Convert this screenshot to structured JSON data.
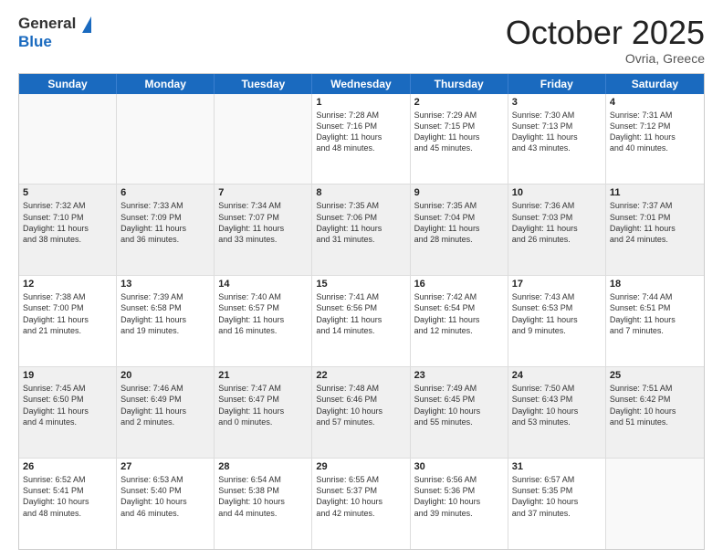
{
  "header": {
    "logo_line1": "General",
    "logo_line2": "Blue",
    "month": "October 2025",
    "location": "Ovria, Greece"
  },
  "weekdays": [
    "Sunday",
    "Monday",
    "Tuesday",
    "Wednesday",
    "Thursday",
    "Friday",
    "Saturday"
  ],
  "weeks": [
    [
      {
        "day": "",
        "info": ""
      },
      {
        "day": "",
        "info": ""
      },
      {
        "day": "",
        "info": ""
      },
      {
        "day": "1",
        "info": "Sunrise: 7:28 AM\nSunset: 7:16 PM\nDaylight: 11 hours\nand 48 minutes."
      },
      {
        "day": "2",
        "info": "Sunrise: 7:29 AM\nSunset: 7:15 PM\nDaylight: 11 hours\nand 45 minutes."
      },
      {
        "day": "3",
        "info": "Sunrise: 7:30 AM\nSunset: 7:13 PM\nDaylight: 11 hours\nand 43 minutes."
      },
      {
        "day": "4",
        "info": "Sunrise: 7:31 AM\nSunset: 7:12 PM\nDaylight: 11 hours\nand 40 minutes."
      }
    ],
    [
      {
        "day": "5",
        "info": "Sunrise: 7:32 AM\nSunset: 7:10 PM\nDaylight: 11 hours\nand 38 minutes."
      },
      {
        "day": "6",
        "info": "Sunrise: 7:33 AM\nSunset: 7:09 PM\nDaylight: 11 hours\nand 36 minutes."
      },
      {
        "day": "7",
        "info": "Sunrise: 7:34 AM\nSunset: 7:07 PM\nDaylight: 11 hours\nand 33 minutes."
      },
      {
        "day": "8",
        "info": "Sunrise: 7:35 AM\nSunset: 7:06 PM\nDaylight: 11 hours\nand 31 minutes."
      },
      {
        "day": "9",
        "info": "Sunrise: 7:35 AM\nSunset: 7:04 PM\nDaylight: 11 hours\nand 28 minutes."
      },
      {
        "day": "10",
        "info": "Sunrise: 7:36 AM\nSunset: 7:03 PM\nDaylight: 11 hours\nand 26 minutes."
      },
      {
        "day": "11",
        "info": "Sunrise: 7:37 AM\nSunset: 7:01 PM\nDaylight: 11 hours\nand 24 minutes."
      }
    ],
    [
      {
        "day": "12",
        "info": "Sunrise: 7:38 AM\nSunset: 7:00 PM\nDaylight: 11 hours\nand 21 minutes."
      },
      {
        "day": "13",
        "info": "Sunrise: 7:39 AM\nSunset: 6:58 PM\nDaylight: 11 hours\nand 19 minutes."
      },
      {
        "day": "14",
        "info": "Sunrise: 7:40 AM\nSunset: 6:57 PM\nDaylight: 11 hours\nand 16 minutes."
      },
      {
        "day": "15",
        "info": "Sunrise: 7:41 AM\nSunset: 6:56 PM\nDaylight: 11 hours\nand 14 minutes."
      },
      {
        "day": "16",
        "info": "Sunrise: 7:42 AM\nSunset: 6:54 PM\nDaylight: 11 hours\nand 12 minutes."
      },
      {
        "day": "17",
        "info": "Sunrise: 7:43 AM\nSunset: 6:53 PM\nDaylight: 11 hours\nand 9 minutes."
      },
      {
        "day": "18",
        "info": "Sunrise: 7:44 AM\nSunset: 6:51 PM\nDaylight: 11 hours\nand 7 minutes."
      }
    ],
    [
      {
        "day": "19",
        "info": "Sunrise: 7:45 AM\nSunset: 6:50 PM\nDaylight: 11 hours\nand 4 minutes."
      },
      {
        "day": "20",
        "info": "Sunrise: 7:46 AM\nSunset: 6:49 PM\nDaylight: 11 hours\nand 2 minutes."
      },
      {
        "day": "21",
        "info": "Sunrise: 7:47 AM\nSunset: 6:47 PM\nDaylight: 11 hours\nand 0 minutes."
      },
      {
        "day": "22",
        "info": "Sunrise: 7:48 AM\nSunset: 6:46 PM\nDaylight: 10 hours\nand 57 minutes."
      },
      {
        "day": "23",
        "info": "Sunrise: 7:49 AM\nSunset: 6:45 PM\nDaylight: 10 hours\nand 55 minutes."
      },
      {
        "day": "24",
        "info": "Sunrise: 7:50 AM\nSunset: 6:43 PM\nDaylight: 10 hours\nand 53 minutes."
      },
      {
        "day": "25",
        "info": "Sunrise: 7:51 AM\nSunset: 6:42 PM\nDaylight: 10 hours\nand 51 minutes."
      }
    ],
    [
      {
        "day": "26",
        "info": "Sunrise: 6:52 AM\nSunset: 5:41 PM\nDaylight: 10 hours\nand 48 minutes."
      },
      {
        "day": "27",
        "info": "Sunrise: 6:53 AM\nSunset: 5:40 PM\nDaylight: 10 hours\nand 46 minutes."
      },
      {
        "day": "28",
        "info": "Sunrise: 6:54 AM\nSunset: 5:38 PM\nDaylight: 10 hours\nand 44 minutes."
      },
      {
        "day": "29",
        "info": "Sunrise: 6:55 AM\nSunset: 5:37 PM\nDaylight: 10 hours\nand 42 minutes."
      },
      {
        "day": "30",
        "info": "Sunrise: 6:56 AM\nSunset: 5:36 PM\nDaylight: 10 hours\nand 39 minutes."
      },
      {
        "day": "31",
        "info": "Sunrise: 6:57 AM\nSunset: 5:35 PM\nDaylight: 10 hours\nand 37 minutes."
      },
      {
        "day": "",
        "info": ""
      }
    ]
  ]
}
